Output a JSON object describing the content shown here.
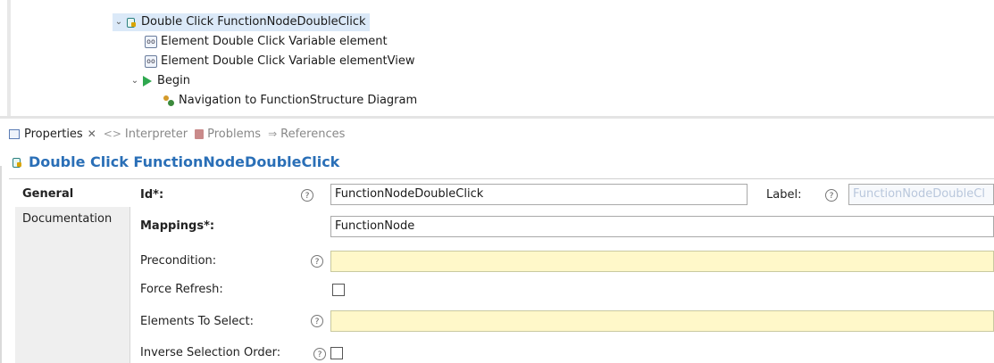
{
  "tree": {
    "items": [
      {
        "label": "Double Click FunctionNodeDoubleClick",
        "icon": "tool-icon",
        "expanded": true,
        "selected": true
      },
      {
        "label": "Element Double Click Variable element",
        "icon": "variable-icon"
      },
      {
        "label": "Element Double Click Variable elementView",
        "icon": "variable-icon"
      },
      {
        "label": "Begin",
        "icon": "play-icon",
        "expanded": true
      },
      {
        "label": "Navigation to FunctionStructure Diagram",
        "icon": "navigation-icon"
      }
    ],
    "var_glyph": "oo"
  },
  "tabs": {
    "properties": "Properties",
    "properties_close": "✕",
    "interpreter": "Interpreter",
    "problems": "Problems",
    "references": "References"
  },
  "title": "Double Click FunctionNodeDoubleClick",
  "sidetabs": [
    "General",
    "Documentation"
  ],
  "form": {
    "id_label": "Id*:",
    "id_value": "FunctionNodeDoubleClick",
    "label_label": "Label:",
    "label_value": "FunctionNodeDoubleCl",
    "mappings_label": "Mappings*:",
    "mappings_value": "FunctionNode",
    "precondition_label": "Precondition:",
    "precondition_value": "",
    "force_refresh_label": "Force Refresh:",
    "elements_to_select_label": "Elements To Select:",
    "elements_to_select_value": "",
    "inverse_selection_label": "Inverse Selection Order:",
    "help_glyph": "?"
  },
  "colors": {
    "accent": "#2a6fb7",
    "selection": "#dbe9f8",
    "required_field": "#fff8c9"
  }
}
